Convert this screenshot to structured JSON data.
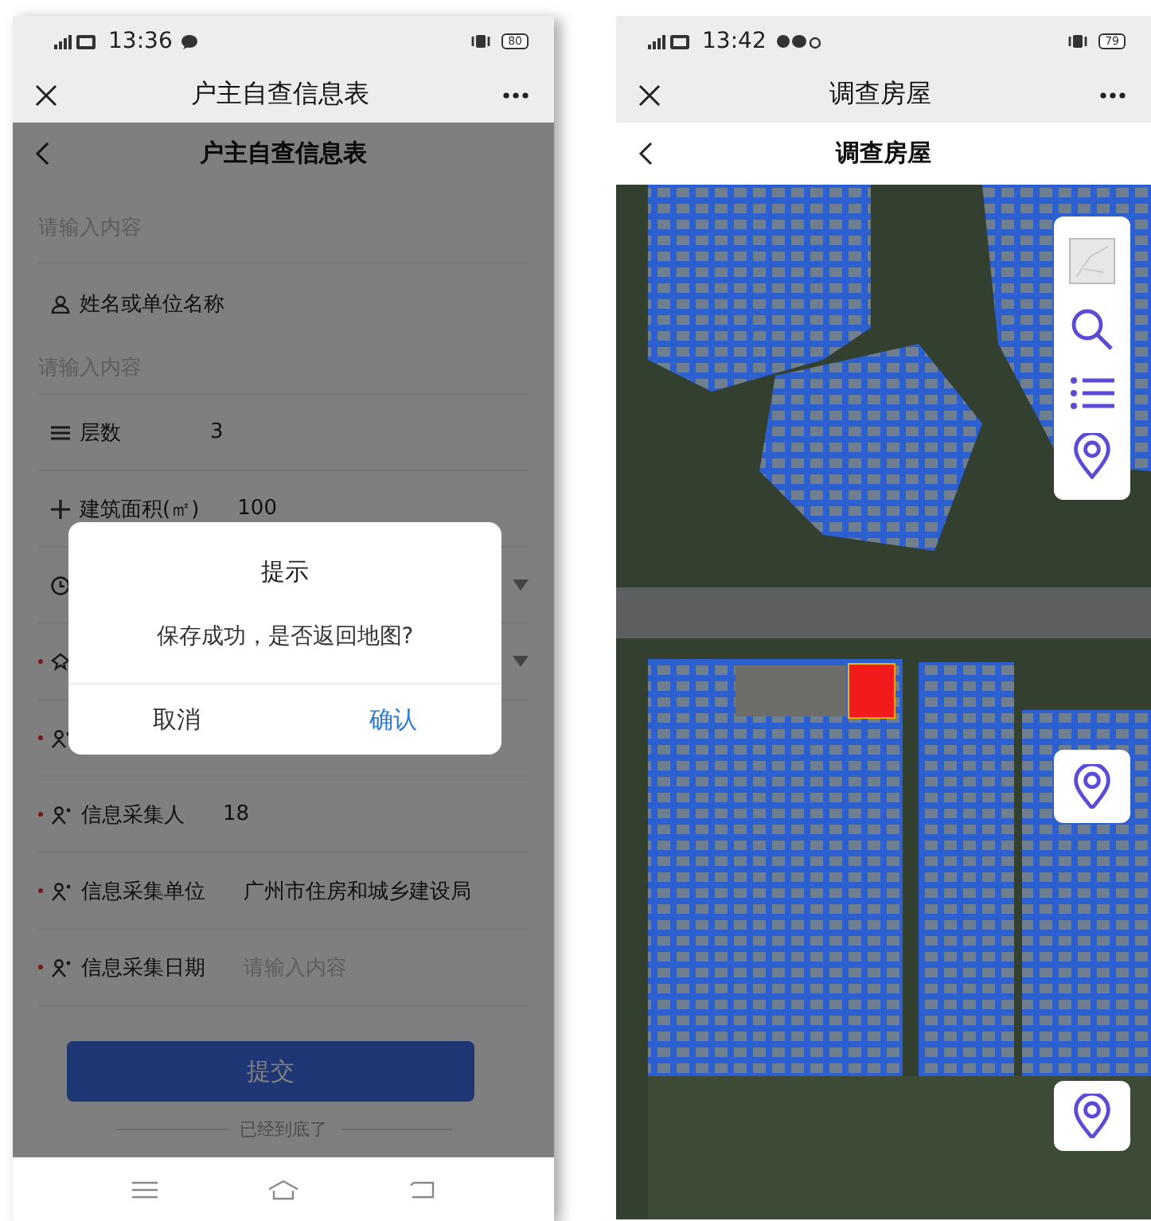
{
  "form_screen": {
    "status_bar": {
      "time": "13:36",
      "battery": "80"
    },
    "nav_bar": {
      "title": "户主自查信息表"
    },
    "header": {
      "title": "户主自查信息表"
    },
    "rows": [
      {
        "kind": "input",
        "placeholder": "请输入内容",
        "required": false
      },
      {
        "kind": "heading",
        "label": "姓名或单位名称",
        "required": false
      },
      {
        "kind": "input",
        "placeholder": "请输入内容",
        "required": false
      },
      {
        "kind": "field",
        "label": "层数",
        "value": "3",
        "required": false
      },
      {
        "kind": "field",
        "label": "建筑面积(㎡)",
        "value": "100",
        "required": false
      },
      {
        "kind": "select",
        "required": false
      },
      {
        "kind": "select",
        "required": true
      },
      {
        "kind": "field",
        "required": true
      },
      {
        "kind": "field",
        "label": "信息采集人",
        "value": "18",
        "required": true
      },
      {
        "kind": "field",
        "label": "信息采集单位",
        "value": "广州市住房和城乡建设局",
        "required": true
      },
      {
        "kind": "field",
        "label": "信息采集日期",
        "placeholder": "请输入内容",
        "required": true
      }
    ],
    "submit": "提交",
    "end_note": "已经到底了",
    "dialog": {
      "title": "提示",
      "message": "保存成功，是否返回地图?",
      "buttons": [
        {
          "label": "取消",
          "kind": "cancel"
        },
        {
          "label": "确认",
          "kind": "confirm"
        }
      ]
    }
  },
  "map_screen": {
    "status_bar": {
      "time": "13:42",
      "battery": "79"
    },
    "nav_bar": {
      "title": "调查房屋"
    },
    "header": {
      "title": "调查房屋"
    }
  }
}
